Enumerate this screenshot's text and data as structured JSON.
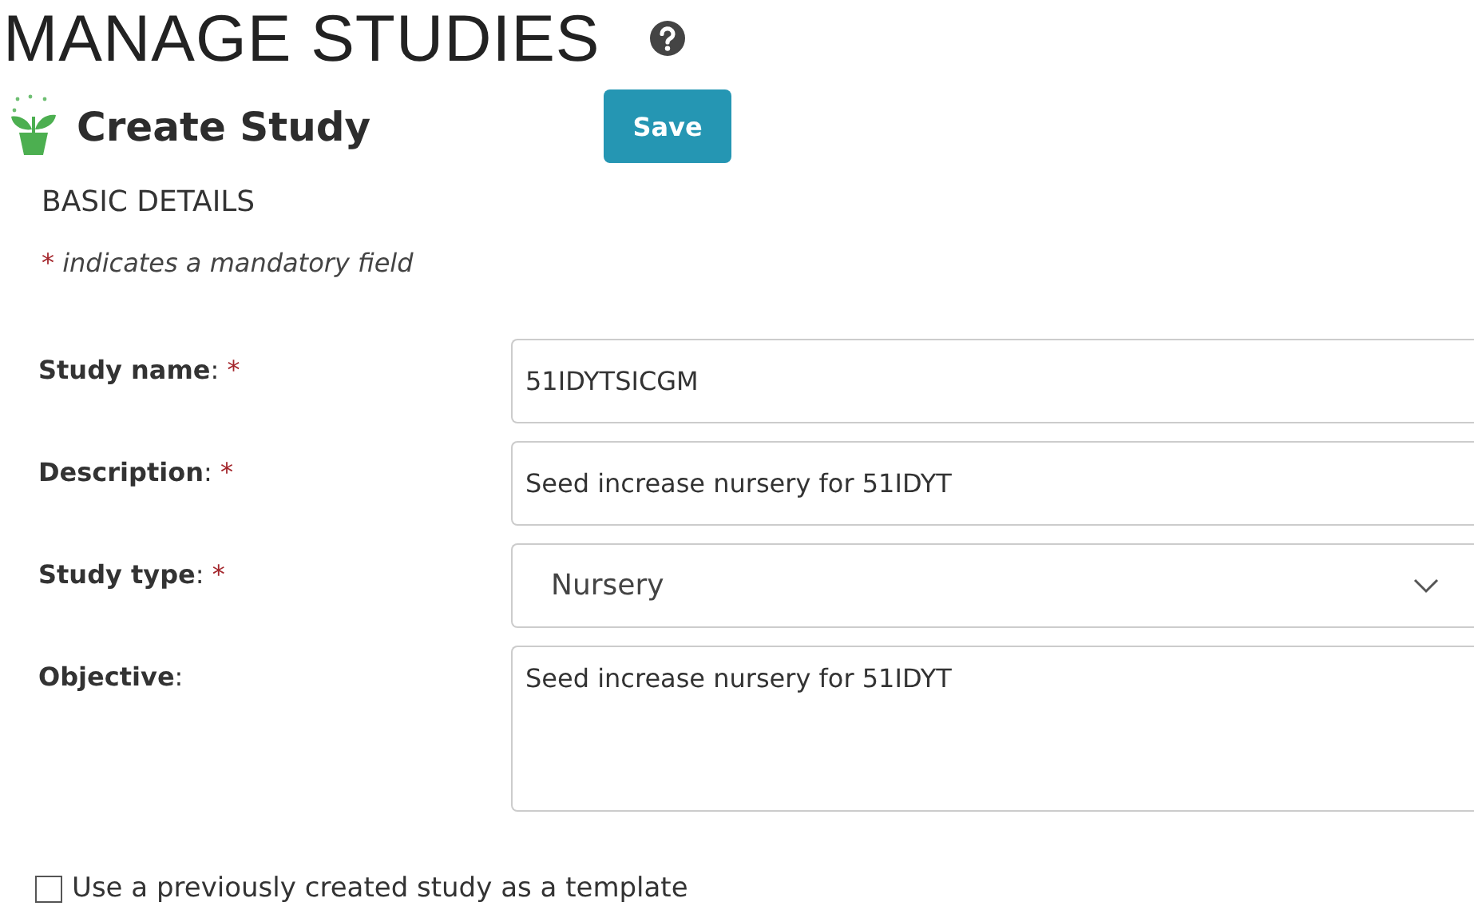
{
  "page_title": "MANAGE STUDIES",
  "subtitle": "Create Study",
  "save_button": "Save",
  "section_title": "BASIC DETAILS",
  "mandatory_note": {
    "mark": "*",
    "text": "indicates a mandatory field"
  },
  "fields": [
    {
      "label": "**Study name**:",
      "required": true,
      "kind": "text",
      "value": "51IDYTSICGM"
    },
    {
      "label": "**Description**:",
      "required": true,
      "kind": "text",
      "value": "Seed increase nursery for 51IDYT"
    },
    {
      "label": "**Study type**:",
      "required": true,
      "kind": "select",
      "value": "Nursery"
    },
    {
      "label": "**Objective**:",
      "required": false,
      "kind": "textarea",
      "value": "Seed increase nursery for 51IDYT"
    }
  ],
  "template_option": {
    "label": "Use a previously created study as a template",
    "checked": false
  }
}
